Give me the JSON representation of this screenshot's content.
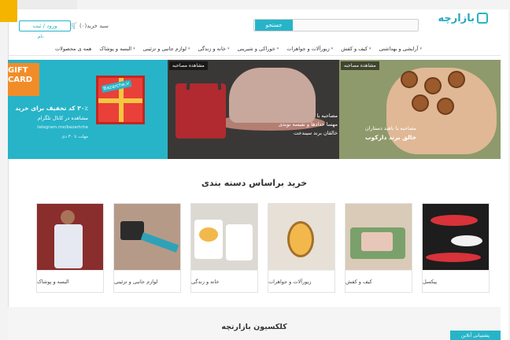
{
  "header": {
    "logo_text": "بازارچه",
    "search_placeholder": "",
    "search_button": "جستجو",
    "cart_label": "سبد خرید(۰)",
    "login_button": "ورود / ثبت",
    "register_link": "نام"
  },
  "nav": {
    "items": [
      "همه ی محصولات",
      "البسه و پوشاک",
      "لوازم جانبی و تزئینی",
      "خانه و زندگی",
      "خوراکی و شیرینی",
      "زیورآلات و جواهرات",
      "کیف و کفش",
      "آرایشی و بهداشتی"
    ]
  },
  "banners": {
    "gift": {
      "label": "GIFT CARD",
      "box_label": "Bazarche.ir",
      "line1": "۳۰٪ کد تخفیف برای خرید",
      "line2": "مشاهده در کانال تلگرام",
      "line3": "telegram.me/bazartche",
      "line4": "مهلت تا ۳۰ دی"
    },
    "hat": {
      "tag": "مشاهده مصاحبه",
      "line1": "مصاحبه با",
      "line2": "مهسا حدادها و نفیسه نوبدی",
      "line3": "خالقان برند سیندخت"
    },
    "nuts": {
      "tag": "مشاهده مصاحبه",
      "line1": "مصاحبه با ناهید دستاران",
      "line2": "خالق برند دارکوب"
    }
  },
  "categories": {
    "title": "خرید براساس دسته بندی",
    "items": [
      {
        "label": "پیکسل"
      },
      {
        "label": "کیف و کفش"
      },
      {
        "label": "زیورآلات و جواهرات"
      },
      {
        "label": "خانه و زندگی"
      },
      {
        "label": "لوازم جانبی و تزئینی"
      },
      {
        "label": "البسه و پوشاک"
      }
    ]
  },
  "collection": {
    "title": "کلکسیون بازارتچه"
  },
  "chat": {
    "label": "پشتیبانی آنلاین"
  },
  "colors": {
    "accent": "#27b4c8",
    "corner": "#f4b400"
  }
}
